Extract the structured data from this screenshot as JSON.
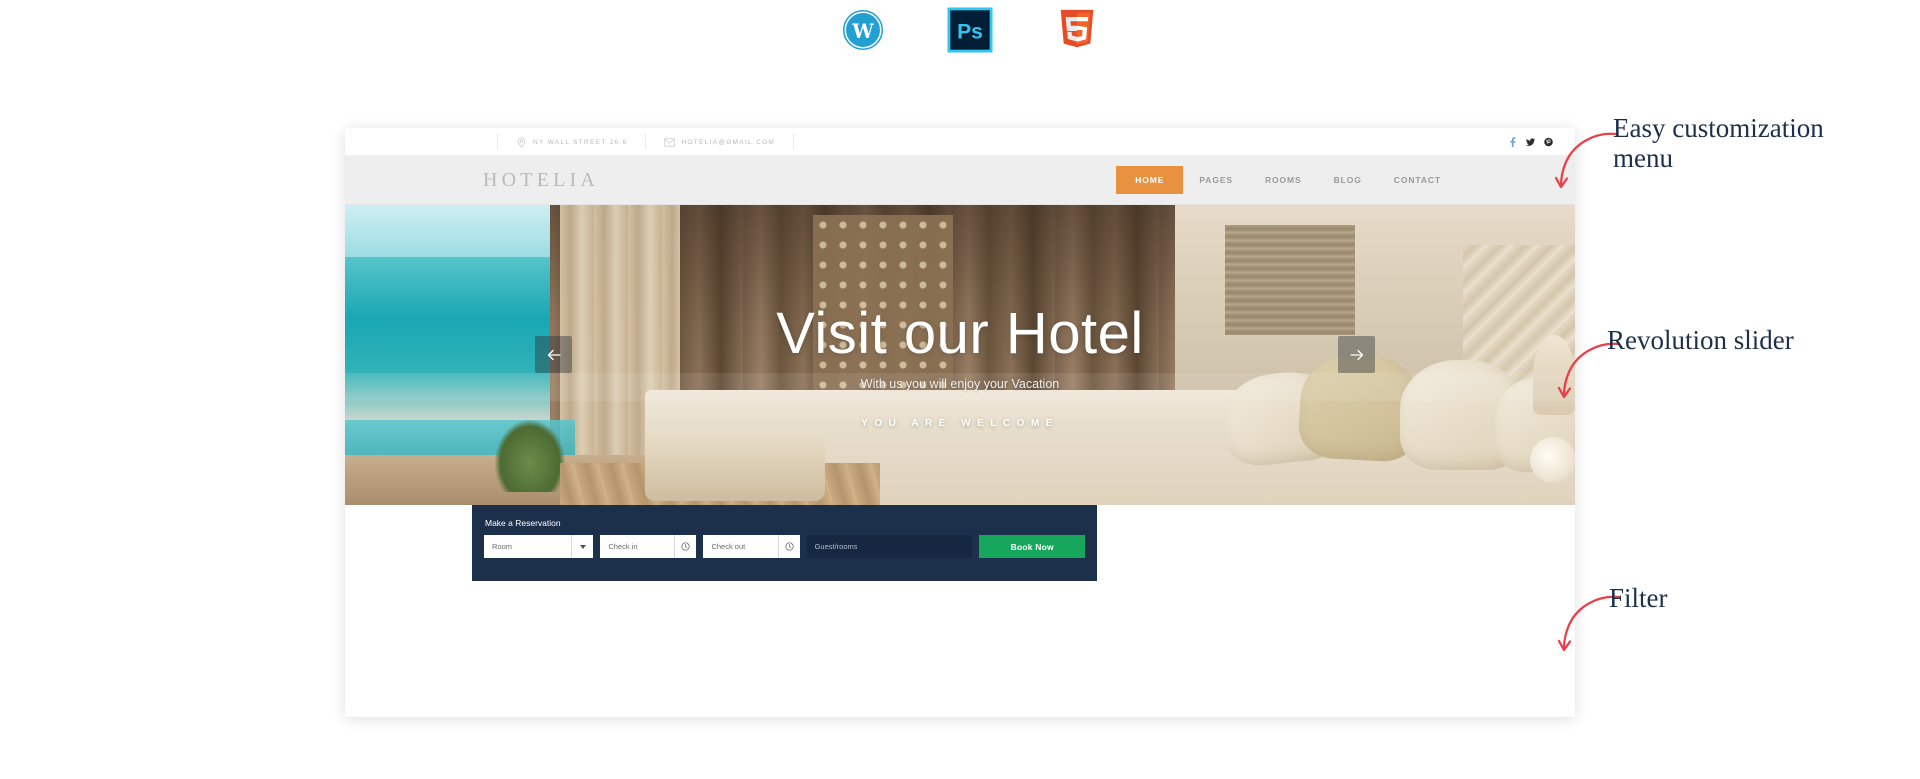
{
  "tech_icons": [
    {
      "name": "wordpress-icon",
      "label": "WordPress",
      "color": "#21a0d1"
    },
    {
      "name": "photoshop-icon",
      "label": "Ps",
      "color": "#31c5f0",
      "bg": "#001e36"
    },
    {
      "name": "html5-icon",
      "label": "HTML5",
      "color": "#e44d26"
    }
  ],
  "site": {
    "topbar": {
      "address": "NY WALL STREET 26.6",
      "email": "HOTELIA@GMAIL.COM",
      "socials": [
        {
          "name": "facebook-icon",
          "label": "f"
        },
        {
          "name": "twitter-icon",
          "label": "t"
        },
        {
          "name": "pinterest-icon",
          "label": "p"
        }
      ]
    },
    "logo": "HOTELIA",
    "nav": [
      {
        "label": "HOME",
        "active": true
      },
      {
        "label": "PAGES",
        "active": false
      },
      {
        "label": "ROOMS",
        "active": false
      },
      {
        "label": "BLOG",
        "active": false
      },
      {
        "label": "CONTACT",
        "active": false
      }
    ],
    "hero": {
      "title": "Visit our Hotel",
      "subtitle": "With us you will enjoy your Vacation",
      "welcome": "YOU ARE WELCOME",
      "prev_label": "Previous slide",
      "next_label": "Next slide"
    },
    "reservation": {
      "title": "Make a Reservation",
      "room_value": "Room",
      "checkin_placeholder": "Check in",
      "checkout_placeholder": "Check out",
      "guest_placeholder": "Guest/rooms",
      "book_label": "Book Now"
    },
    "colors": {
      "accent_orange": "#e8913f",
      "nav_bg": "#eeeeee",
      "reserve_bg": "#1c2f4b",
      "book_green": "#16a75c",
      "annotation_navy": "#1d3048",
      "arrow_red": "#e8414a"
    }
  },
  "annotations": [
    {
      "name": "annotation-easy-customization",
      "text": "Easy customization\nmenu"
    },
    {
      "name": "annotation-revolution-slider",
      "text": "Revolution slider"
    },
    {
      "name": "annotation-filter",
      "text": "Filter"
    }
  ]
}
